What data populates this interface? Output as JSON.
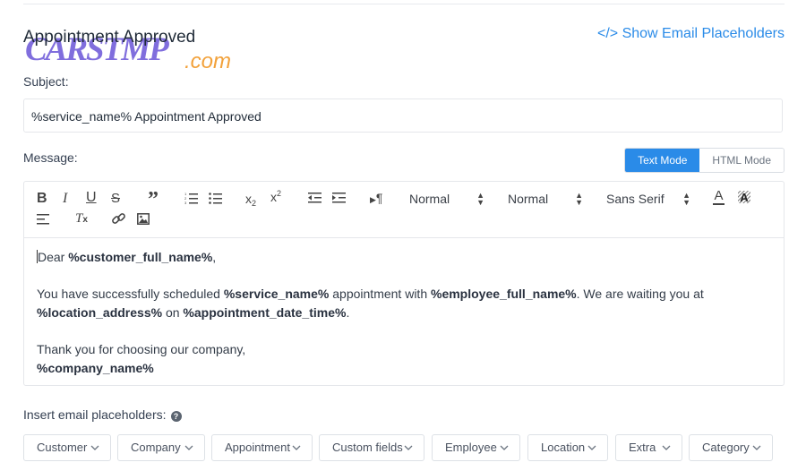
{
  "header": {
    "title": "Appointment Approved",
    "watermark_main": "CARSTMP",
    "watermark_suffix": ".com",
    "show_placeholders_link": "</> Show Email Placeholders"
  },
  "subject": {
    "label": "Subject:",
    "value": "%service_name% Appointment Approved"
  },
  "message": {
    "label": "Message:",
    "modes": [
      "Text Mode",
      "HTML Mode"
    ],
    "active_mode": "Text Mode"
  },
  "toolbar": {
    "header_select": "Normal",
    "size_select": "Normal",
    "font_select": "Sans Serif",
    "icons": [
      "bold-icon",
      "italic-icon",
      "underline-icon",
      "strikethrough-icon",
      "blockquote-icon",
      "ordered-list-icon",
      "bullet-list-icon",
      "subscript-icon",
      "superscript-icon",
      "outdent-icon",
      "indent-icon",
      "rtl-icon",
      "font-color-icon",
      "background-color-icon",
      "align-left-icon",
      "clear-format-icon",
      "link-icon",
      "image-icon"
    ]
  },
  "body": {
    "greeting_prefix": "Dear ",
    "greeting_var": "%customer_full_name%",
    "greeting_suffix": ",",
    "l1_a": "You have successfully scheduled ",
    "l1_var1": "%service_name%",
    "l1_b": " appointment with ",
    "l1_var2": "%employee_full_name%",
    "l1_c": ". We are waiting you at",
    "l2_var1": "%location_address%",
    "l2_a": " on ",
    "l2_var2": "%appointment_date_time%",
    "l2_b": ".",
    "closing": "Thank you for choosing our company,",
    "signature_var": "%company_name%"
  },
  "placeholders": {
    "label": "Insert email placeholders:",
    "help_icon": "?",
    "buttons": [
      "Customer",
      "Company",
      "Appointment",
      "Custom fields",
      "Employee",
      "Location",
      "Extra",
      "Category"
    ]
  },
  "colors": {
    "accent": "#2a8be8",
    "text": "#354052",
    "border": "#e5e7eb"
  }
}
